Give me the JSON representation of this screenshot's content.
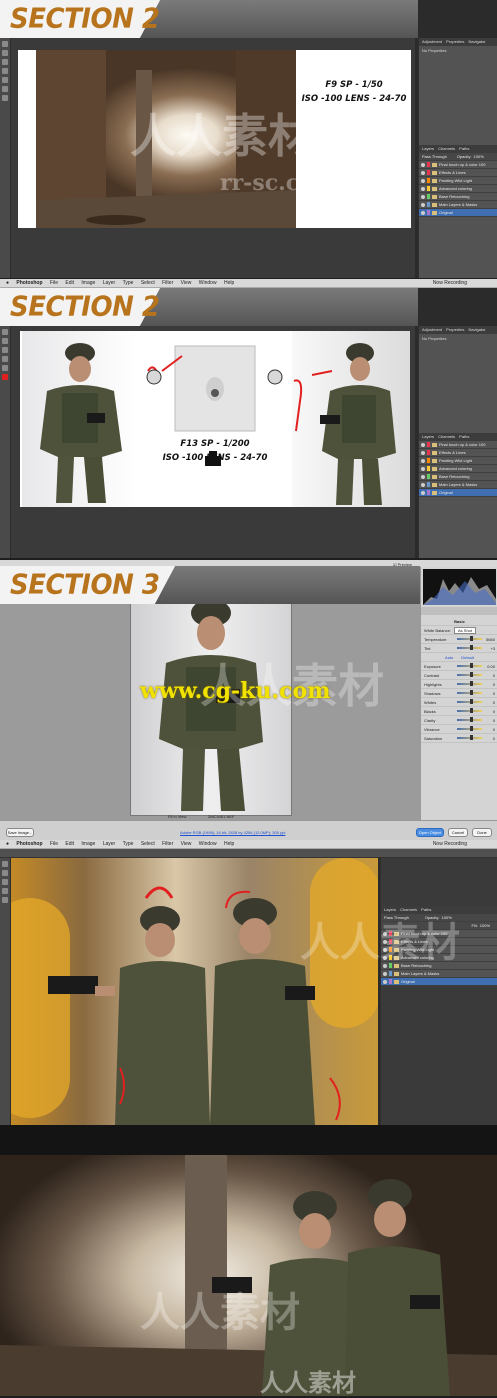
{
  "sections": [
    {
      "title": "SECTION 2",
      "settings_line1": "F9 SP - 1/50",
      "settings_line2": "ISO -100 LENS - 24-70"
    },
    {
      "title": "SECTION 2",
      "settings_line1": "F13 SP - 1/200",
      "settings_line2": "ISO -100 LENS - 24-70"
    },
    {
      "title": "SECTION 3"
    }
  ],
  "menubar": {
    "app": "Photoshop",
    "items": [
      "File",
      "Edit",
      "Image",
      "Layer",
      "Type",
      "Select",
      "Filter",
      "View",
      "Window",
      "Help"
    ],
    "recording": "Now Recording"
  },
  "ps_panel": {
    "tabs": [
      "Adjustment",
      "Properties",
      "Navigator"
    ],
    "no_properties": "No Properties",
    "layer_tabs": [
      "Layers",
      "Channels",
      "Paths"
    ],
    "blend_mode": "Pass Through",
    "opacity_label": "Opacity:",
    "opacity_value": "100%",
    "fill_label": "Fill:",
    "fill_value": "100%",
    "layers": [
      "Final touch up & color 100",
      "Effects & Lines",
      "Painting Wild Light",
      "Advanced coloring",
      "Base Retouching",
      "Main Layers & Masks",
      "Original"
    ]
  },
  "camera_raw": {
    "preview_label": "Preview",
    "basic_label": "Basic",
    "white_balance_label": "White Balance:",
    "white_balance_value": "As Shot",
    "sliders": [
      {
        "label": "Temperature",
        "value": "5650"
      },
      {
        "label": "Tint",
        "value": "+3"
      },
      {
        "label": "Exposure",
        "value": "0.00"
      },
      {
        "label": "Contrast",
        "value": "0"
      },
      {
        "label": "Highlights",
        "value": "0"
      },
      {
        "label": "Shadows",
        "value": "0"
      },
      {
        "label": "Whites",
        "value": "0"
      },
      {
        "label": "Blacks",
        "value": "0"
      },
      {
        "label": "Clarity",
        "value": "0"
      },
      {
        "label": "Vibrance",
        "value": "0"
      },
      {
        "label": "Saturation",
        "value": "0"
      }
    ],
    "auto": "Auto",
    "default": "Default",
    "zoom": "Fit in View",
    "filename": "2MC5451.NEF",
    "info": "Adobe RGB (1998); 16 bit; 2828 by 4256 (12.0MP); 300 ppi",
    "save_button": "Save Image...",
    "open_button": "Open Object",
    "cancel_button": "Cancel",
    "done_button": "Done"
  },
  "watermarks": [
    "人人素材",
    "www.cg-ku.com",
    "rr-sc.com"
  ],
  "colors": {
    "title_orange": "#b8741c",
    "cgku_yellow": "#f2e200",
    "annotation_red": "#e22020"
  }
}
